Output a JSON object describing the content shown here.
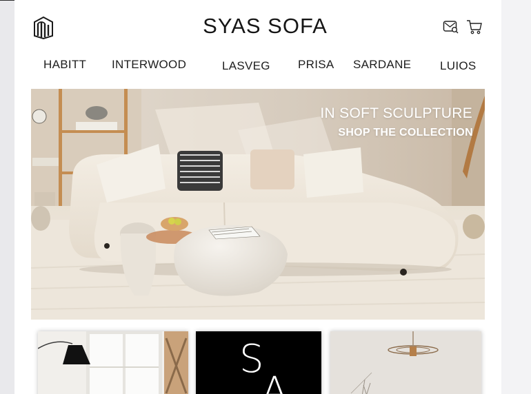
{
  "header": {
    "brand": "SYAS SOFA",
    "logo_icon": "logo-icon",
    "icons": [
      "search-icon",
      "cart-icon"
    ]
  },
  "nav": {
    "items": [
      "HABITT",
      "INTERWOOD",
      "LASVEG",
      "PRISA",
      "SARDANE",
      "LUIOS"
    ]
  },
  "hero": {
    "title": "IN SOFT SCULPTURE",
    "cta": "SHOP THE COLLECTION"
  },
  "cards": {
    "middle_letters": [
      "S",
      "A"
    ]
  },
  "colors": {
    "text": "#151515",
    "page_bg": "#ffffff",
    "sofa": "#ece4d7",
    "black_card": "#000000"
  }
}
